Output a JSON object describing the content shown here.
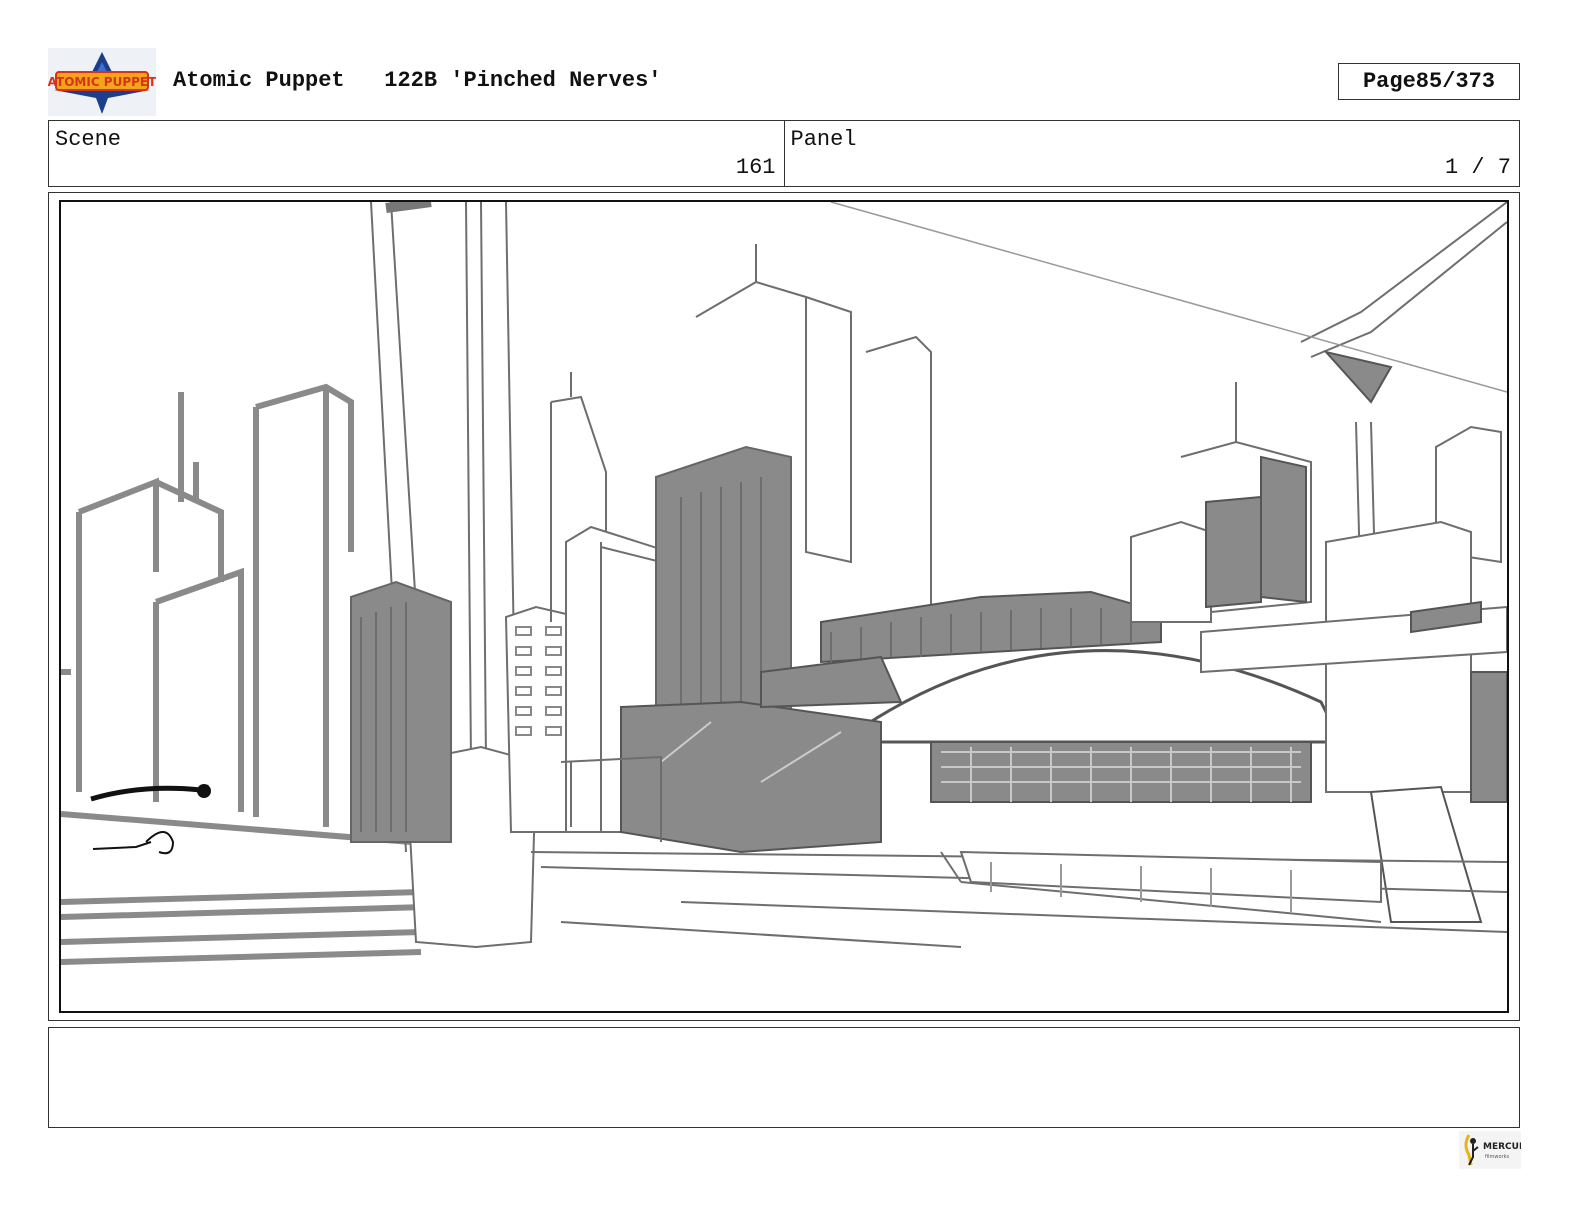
{
  "header": {
    "show_title": "Atomic Puppet",
    "episode": "122B 'Pinched Nerves'",
    "page_label": "Page",
    "page_number": "85/373"
  },
  "info": {
    "scene_label": "Scene",
    "scene_value": "161",
    "panel_label": "Panel",
    "panel_value": "1 / 7"
  },
  "logos": {
    "show_logo_icon": "atomic-puppet-logo",
    "studio_logo_icon": "mercury-filmworks-logo",
    "brand_colors": [
      "#1d3f8a",
      "#f2a516",
      "#d8321e"
    ]
  },
  "panel": {
    "art_description_icon": "city-skyline-sketch"
  },
  "notes": {
    "text": ""
  }
}
